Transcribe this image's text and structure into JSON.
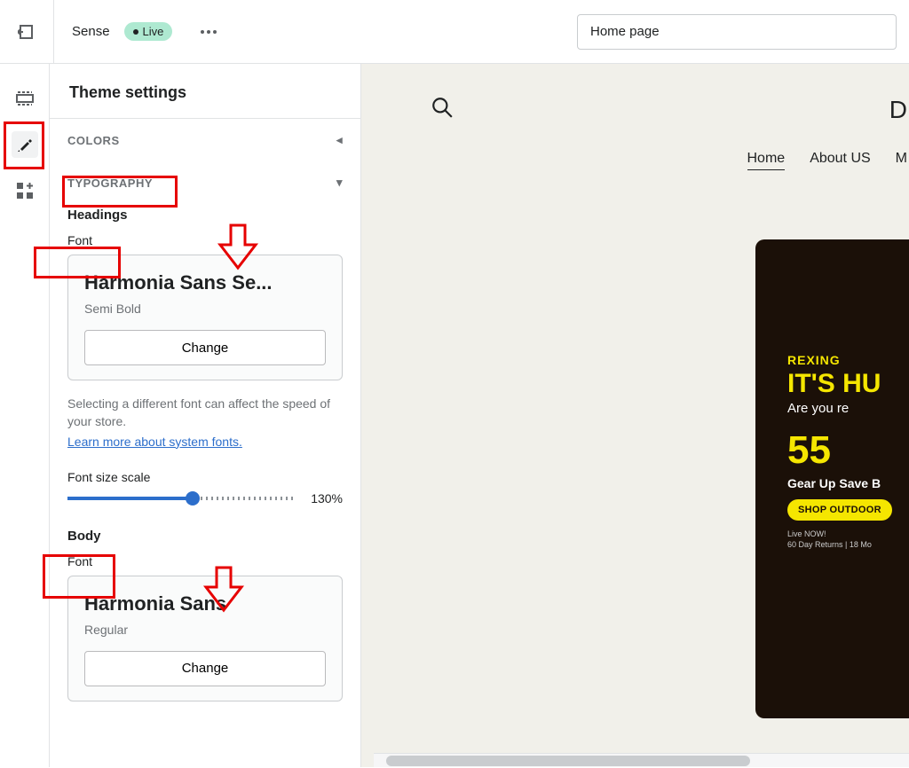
{
  "topbar": {
    "theme_name": "Sense",
    "live_badge": "Live",
    "page_dropdown": "Home page"
  },
  "panel": {
    "title": "Theme settings",
    "colors_section": "Colors",
    "typography_section": "Typography",
    "headings_label": "Headings",
    "font_label": "Font",
    "heading_font_name": "Harmonia Sans Se...",
    "heading_font_style": "Semi Bold",
    "change_button": "Change",
    "help_text": "Selecting a different font can affect the speed of your store.",
    "help_link": "Learn more about system fonts.",
    "font_size_scale_label": "Font size scale",
    "font_size_scale_value": "130%",
    "font_size_scale_percent": 55,
    "body_label": "Body",
    "body_font_name": "Harmonia Sans",
    "body_font_style": "Regular"
  },
  "preview": {
    "logo": "D",
    "nav": {
      "home": "Home",
      "about": "About US",
      "m": "M"
    },
    "hero": {
      "brand": "REXING",
      "l1": "IT'S HU",
      "l2": "Are you re",
      "big": "55",
      "sub": "Gear Up Save B",
      "cta": "SHOP OUTDOOR",
      "t1": "Live NOW!",
      "t2": "60 Day Returns | 18 Mo"
    }
  }
}
